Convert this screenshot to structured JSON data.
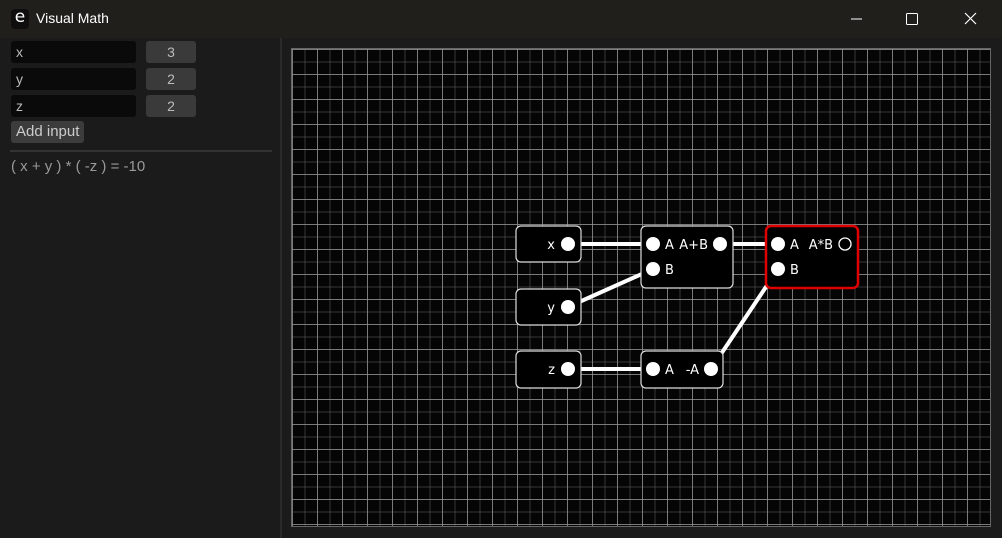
{
  "window": {
    "title": "Visual Math",
    "app_icon": "e",
    "controls": [
      "minimize-icon",
      "maximize-icon",
      "close-icon"
    ]
  },
  "inputs": [
    {
      "name": "x",
      "value": "3"
    },
    {
      "name": "y",
      "value": "2"
    },
    {
      "name": "z",
      "value": "2"
    }
  ],
  "add_input_label": "Add input",
  "expression": "( x + y ) * ( -z ) = -10",
  "graph": {
    "nodes": {
      "x": {
        "label": "x"
      },
      "y": {
        "label": "y"
      },
      "z": {
        "label": "z"
      },
      "add": {
        "in_a": "A",
        "in_b": "B",
        "op": "A+B"
      },
      "neg": {
        "in_a": "A",
        "op": "-A"
      },
      "mul": {
        "in_a": "A",
        "in_b": "B",
        "op": "A*B",
        "selected": true
      }
    },
    "selected_color": "#e00000"
  }
}
